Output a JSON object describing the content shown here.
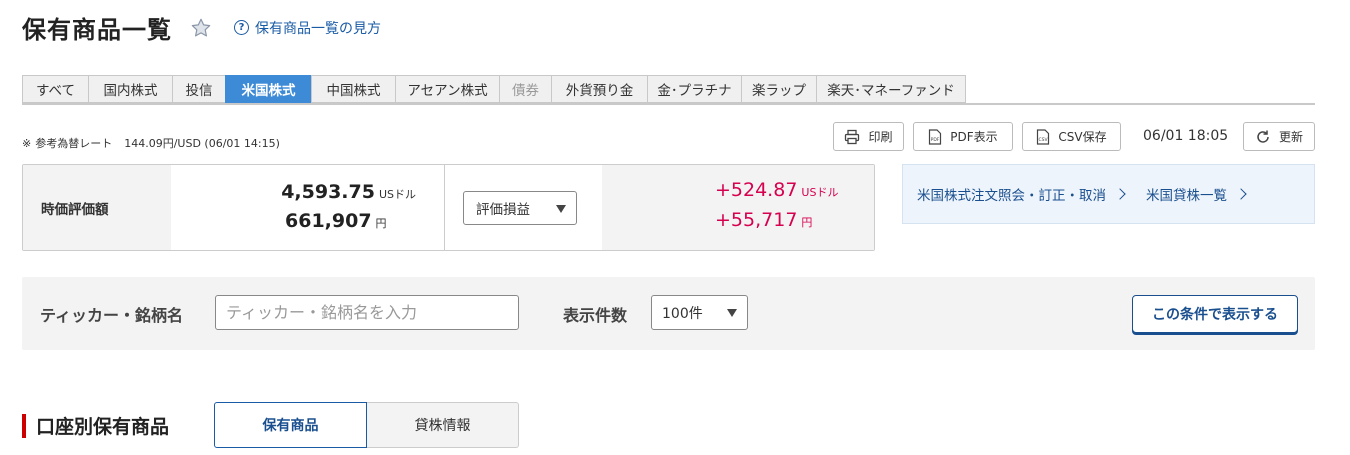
{
  "header": {
    "title": "保有商品一覧",
    "help_link": "保有商品一覧の見方"
  },
  "tabs": [
    {
      "label": "すべて",
      "state": "normal"
    },
    {
      "label": "国内株式",
      "state": "normal"
    },
    {
      "label": "投信",
      "state": "normal"
    },
    {
      "label": "米国株式",
      "state": "active"
    },
    {
      "label": "中国株式",
      "state": "normal"
    },
    {
      "label": "アセアン株式",
      "state": "normal"
    },
    {
      "label": "債券",
      "state": "disabled"
    },
    {
      "label": "外貨預り金",
      "state": "normal"
    },
    {
      "label": "金･プラチナ",
      "state": "normal"
    },
    {
      "label": "楽ラップ",
      "state": "normal"
    },
    {
      "label": "楽天･マネーファンド",
      "state": "normal"
    }
  ],
  "rate_note": {
    "mark": "※",
    "label": "参考為替レート",
    "value": "144.09円/USD (06/01 14:15)"
  },
  "toolbar": {
    "print": "印刷",
    "pdf": "PDF表示",
    "csv": "CSV保存",
    "timestamp": "06/01 18:05",
    "refresh": "更新"
  },
  "summary": {
    "label": "時価評価額",
    "usd_value": "4,593.75",
    "usd_unit": "USドル",
    "jpy_value": "661,907",
    "jpy_unit": "円",
    "select_value": "評価損益",
    "pl_usd": "+524.87",
    "pl_usd_unit": "USドル",
    "pl_jpy": "+55,717",
    "pl_jpy_unit": "円"
  },
  "links": {
    "order_inquiry": "米国株式注文照会・訂正・取消",
    "lending_list": "米国貸株一覧"
  },
  "filter": {
    "ticker_label": "ティッカー・銘柄名",
    "ticker_placeholder": "ティッカー・銘柄名を入力",
    "count_label": "表示件数",
    "count_value": "100件",
    "submit": "この条件で表示する"
  },
  "section": {
    "title": "口座別保有商品",
    "tab_holdings": "保有商品",
    "tab_lending": "貸株情報"
  },
  "colors": {
    "tab_active": "#3d8bd6",
    "link": "#1a5ba6",
    "profit": "#d6004f",
    "section_bar": "#cc0000"
  }
}
